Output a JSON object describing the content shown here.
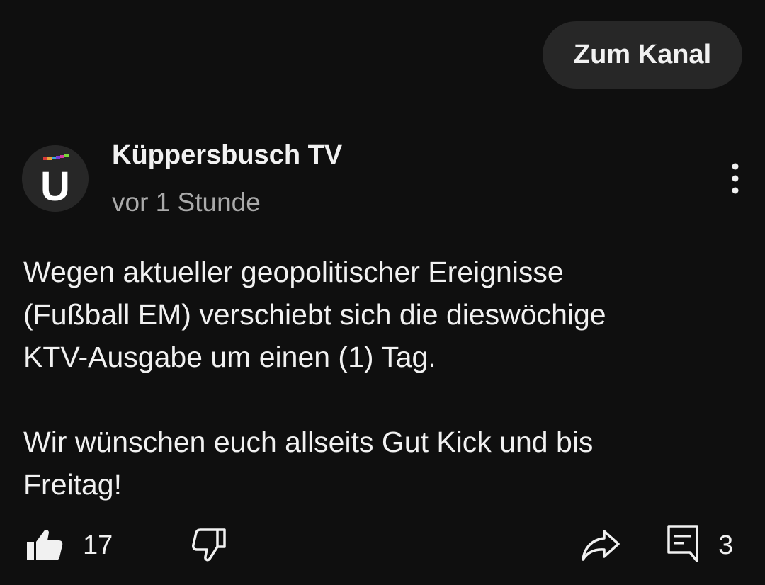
{
  "header": {
    "channel_button_label": "Zum Kanal"
  },
  "post": {
    "avatar_letter": "U",
    "author": "Küppersbusch TV",
    "timestamp": "vor 1 Stunde",
    "paragraphs": [
      [
        "Wegen aktueller geopolitischer Ereignisse",
        "(Fußball EM) verschiebt sich die dieswöchige",
        "KTV-Ausgabe um einen (1) Tag."
      ],
      [
        "Wir wünschen euch allseits Gut Kick und bis",
        "Freitag!"
      ]
    ]
  },
  "actions": {
    "like_count": "17",
    "comment_count": "3"
  },
  "icons": {
    "like": "thumbs-up-icon",
    "dislike": "thumbs-down-icon",
    "share": "share-icon",
    "comments": "comment-icon",
    "more": "more-vertical-icon"
  },
  "colors": {
    "background": "#0f0f0f",
    "button_bg": "#272727",
    "text_primary": "#f1f1f1",
    "text_secondary": "#aaaaaa"
  }
}
